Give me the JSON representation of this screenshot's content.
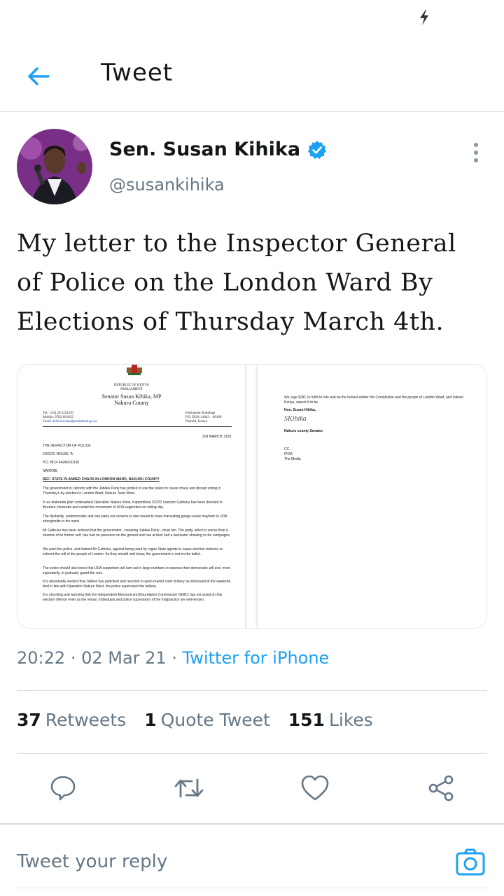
{
  "header": {
    "title": "Tweet",
    "back_icon": "arrow-left-icon"
  },
  "author": {
    "display_name": "Sen. Susan Kihika",
    "handle": "@susankihika",
    "verified": true
  },
  "tweet": {
    "text": "My letter to the Inspector General of Police on the London Ward By Elections of Thursday March 4th.",
    "time": "20:22",
    "date": "02 Mar 21",
    "source": "Twitter for iPhone"
  },
  "letter_page1": {
    "org_line1": "REPUBLIC OF KENYA",
    "org_line2": "PARLIAMENT",
    "sender_name": "Senator Susan Kihika, MP",
    "sender_county": "Nakuru County",
    "tel": "Tel: +254 20 2221291",
    "mobile": "Mobile: 0782-001032",
    "email": "Email: kihika.susan@parliament.go.ke",
    "addr1": "Parliament Buildings",
    "addr2": "P.O. BOX 41842 – 00100",
    "addr3": "Nairobi, Kenya",
    "date": "2nd MARCH, 2021",
    "to1": "THE INSPECTOR OF POLICE",
    "to2": "JOGOO HOUSE 'A'",
    "to3": "P.O. BOX 44249-00100",
    "to4": "NAIROBI.",
    "ref": "REF: STATE PLANNED CHAOS IN LONDON WARD, NAKURU COUNTY",
    "paragraphs": [
      "The government in cahoots with the Jubilee Party has plotted to use the police to cause chaos and disrupt voting in Thursday's by-election in London Ward, Nakuru Town West.",
      "In an elaborate plan codenamed Operation Nakuru West, Kaptembwa OCPD Samson Gathuku has been directed to threaten, blockade and curtail the movement of UDA supporters on voting day.",
      "The dastardly, undemocratic and one-party era scheme is also meant to have marauding gangs cause mayhem in UDA strongholds in the ward.",
      "Mr Gathuku has been ordered that the government - meaning Jubilee Party - must win. The party, which is worse than a shadow of its former self, has had no presence on the ground and has at best had a lackluster showing in the campaigns.",
      "We warn the police, and indeed Mr Gathuku, against being used by rogue State agents to cause election violence or subvert the will of the people of London. As they should well know, the government is not on the ballot.",
      "The police should also know that UDA supporters will turn out in large numbers to express their democratic will and, more importantly, to jealously guard the vote.",
      "It is abundantly evident that Jubilee has panicked and resorted to open-market voter bribery as witnessed at the weekend. And in line with Operation Nakuru West, the police supervised the bribery.",
      "It is shocking and worrying that the Independent Electoral and Boundaries Commission (IEBC) has not acted on this election offence even as the venue, individuals and police supervisors of the malpractice are well-known."
    ]
  },
  "letter_page2": {
    "paragraph": "We urge IEBC to fulfil its role and be the honest arbiter the Constitution and the people of London Ward, and indeed Kenya, expect it to be.",
    "signoff_name": "Hon. Susan Kihika,",
    "signature": "SKihika",
    "signoff_title": "Nakuru county Senator.",
    "cc_label": "CC.",
    "cc1": "IPOA",
    "cc2": "The Media"
  },
  "stats": {
    "retweets_count": "37",
    "retweets_label": "Retweets",
    "quotes_count": "1",
    "quotes_label": "Quote Tweet",
    "likes_count": "151",
    "likes_label": "Likes"
  },
  "reply": {
    "placeholder": "Tweet your reply",
    "camera_icon": "camera-icon"
  },
  "colors": {
    "accent": "#1da1f2",
    "secondary_text": "#657786",
    "primary_text": "#14171a",
    "divider": "#d9dde1"
  }
}
